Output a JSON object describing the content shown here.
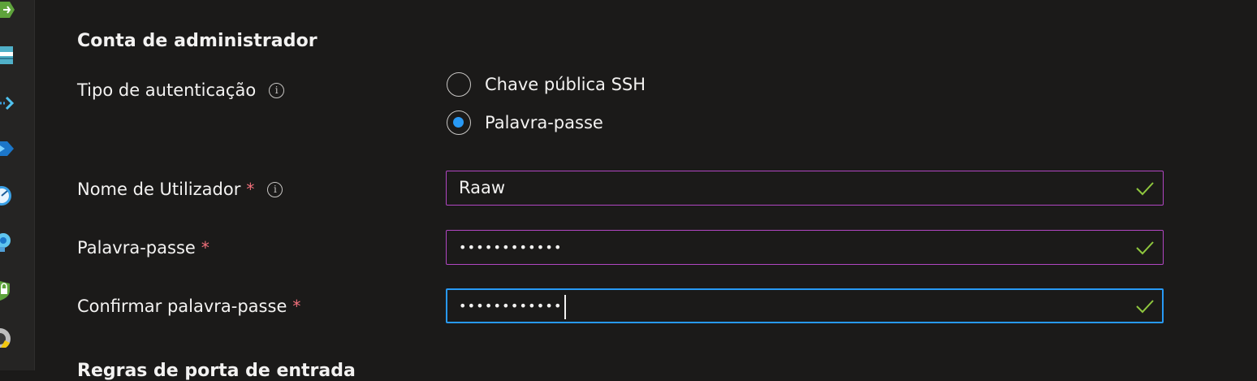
{
  "sidebar": {
    "icons": [
      "diamond-arrow-icon",
      "storage-icon",
      "arrow-chevron-icon",
      "diamond-icon",
      "gauge-icon",
      "cloud-gear-icon",
      "lock-shield-icon",
      "disk-icon"
    ]
  },
  "section": {
    "title": "Conta de administrador",
    "next_title": "Regras de porta de entrada"
  },
  "auth": {
    "label": "Tipo de autenticação",
    "options": [
      {
        "label": "Chave pública SSH",
        "selected": false
      },
      {
        "label": "Palavra-passe",
        "selected": true
      }
    ]
  },
  "username": {
    "label": "Nome de Utilizador",
    "required_mark": "*",
    "value": "Raaw"
  },
  "password": {
    "label": "Palavra-passe",
    "required_mark": "*",
    "value": "••••••••••••"
  },
  "confirm_password": {
    "label": "Confirmar palavra-passe",
    "required_mark": "*",
    "value": "••••••••••••"
  },
  "colors": {
    "accent": "#2899f5",
    "valid_border": "#b146c2",
    "required": "#f1707b",
    "checkmark": "#8fc73e"
  }
}
